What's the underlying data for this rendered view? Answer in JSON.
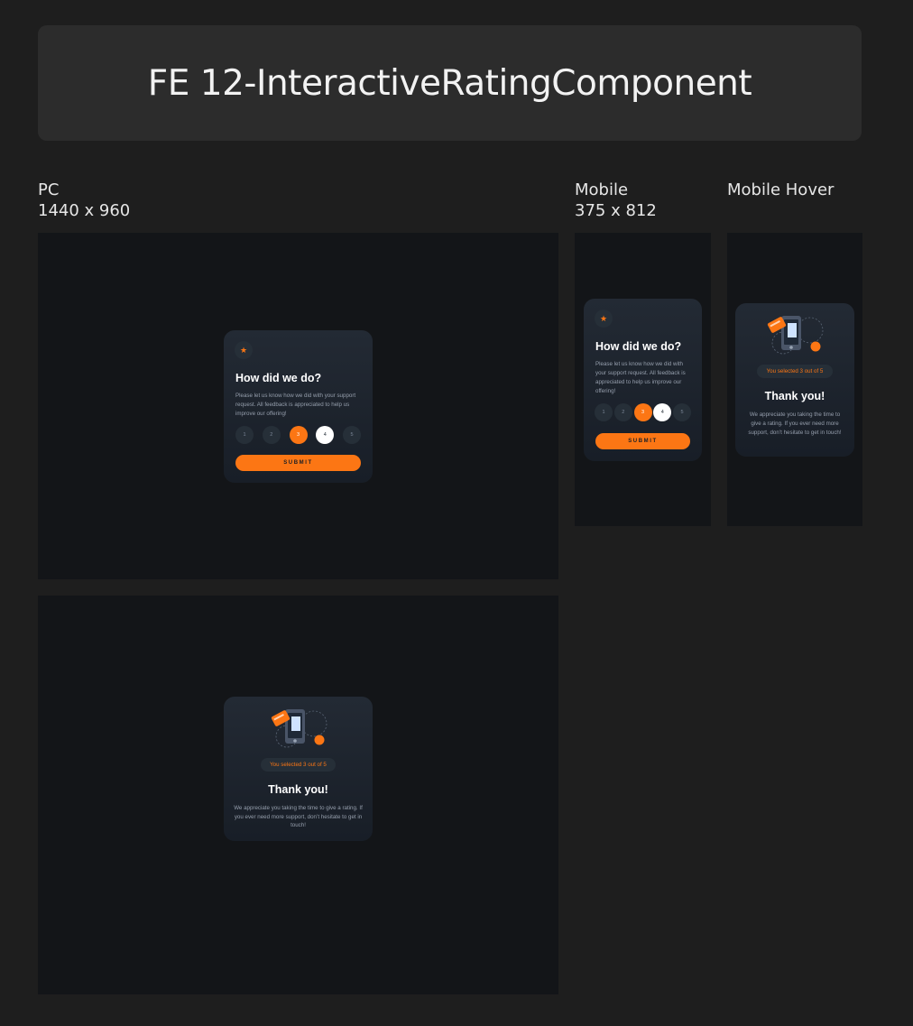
{
  "page_title": "FE 12-InteractiveRatingComponent",
  "labels": {
    "pc": {
      "name": "PC",
      "size": "1440 x 960"
    },
    "mobile": {
      "name": "Mobile",
      "size": "375 x 812"
    },
    "mobile_hover": {
      "name": "Mobile Hover"
    }
  },
  "rating_card": {
    "heading": "How did we do?",
    "description": "Please let us know how we did with your support request. All feedback is appreciated to help us improve our offering!",
    "ratings": [
      "1",
      "2",
      "3",
      "4",
      "5"
    ],
    "selected": "3",
    "hovered": "4",
    "submit_label": "SUBMIT"
  },
  "thank_you_card": {
    "selection_text": "You selected 3 out of 5",
    "heading": "Thank you!",
    "description": "We appreciate you taking the time to give a rating. If you ever need more support, don’t hesitate to get in touch!"
  },
  "colors": {
    "accent": "#fc7614",
    "background": "#131518",
    "card": "#232a34",
    "canvas": "#1e1e1e"
  },
  "icons": {
    "star": "star-icon",
    "illustration": "phone-card-illustration"
  }
}
